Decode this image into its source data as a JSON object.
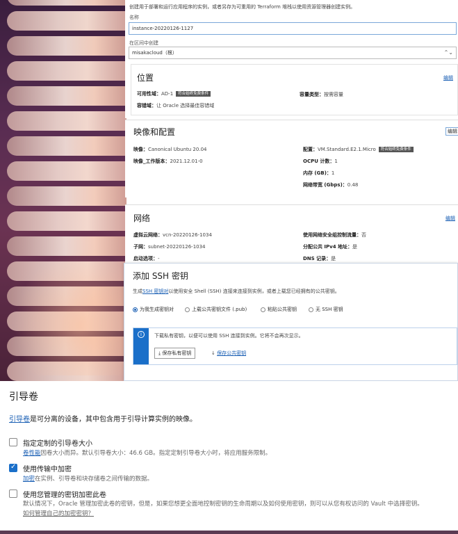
{
  "intro_text": "创建用于部署和运行应用程序的实例，或者另存为可重用的 Terraform 堆栈以使用资源管理器创建实例。",
  "name_label": "名称",
  "name_value": "instance-20220126-1127",
  "compartment_label": "在区间中创建",
  "compartment_value": "misakacloud（根）",
  "placement": {
    "title": "位置",
    "edit": "编辑",
    "ad_label": "可用性域：",
    "ad_value": "AD-1",
    "ad_badge": "符合始终免费条件",
    "capacity_label": "容量类型：",
    "capacity_value": "按需容量",
    "fault_label": "容错域：",
    "fault_value": "让 Oracle 选择最佳容错域"
  },
  "image_shape": {
    "title": "映像和配置",
    "edit": "编辑",
    "image_label": "映像：",
    "image_value": "Canonical Ubuntu 20.04",
    "build_label": "映像_工作版本：",
    "build_value": "2021.12.01-0",
    "shape_label": "配置：",
    "shape_value": "VM.Standard.E2.1.Micro",
    "shape_badge": "符合始终免费条件",
    "ocpu_label": "OCPU 计数：",
    "ocpu_value": "1",
    "mem_label": "内存 (GB)：",
    "mem_value": "1",
    "bw_label": "网络带宽 (Gbps)：",
    "bw_value": "0.48"
  },
  "network": {
    "title": "网络",
    "edit": "编辑",
    "vcn_label": "虚拟云网络：",
    "vcn_value": "vcn-20220126-1034",
    "nsg_label": "使用网络安全组控制流量：",
    "nsg_value": "否",
    "subnet_label": "子网：",
    "subnet_value": "subnet-20220126-1034",
    "ip_label": "分配公共 IPv4 地址：",
    "ip_value": "是",
    "launch_label": "启动选项：",
    "launch_value": "-",
    "dns_label": "DNS 记录：",
    "dns_value": "是"
  },
  "ssh": {
    "title": "添加 SSH 密钥",
    "desc_prefix": "生成",
    "desc_link": "SSH 密钥对",
    "desc_suffix": "以使用安全 Shell (SSH) 连接来连接到实例，或者上载您已经拥有的公共密钥。",
    "options": [
      "为我生成密钥对",
      "上载公共密钥文件 (.pub)",
      "粘贴公共密钥",
      "无 SSH 密钥"
    ],
    "info_text": "下载私有密钥，以便可以使用 SSH 连接到实例。它将不会再次显示。",
    "save_private": "保存私有密钥",
    "save_public": "保存公共密钥"
  },
  "boot": {
    "title": "引导卷",
    "desc_link": "引导卷",
    "desc_rest": "是可分离的设备，其中包含用于引导计算实例的映像。",
    "opt1_label": "指定定制的引导卷大小",
    "opt1_link": "卷性能",
    "opt1_help": "因卷大小而异。默认引导卷大小：46.6 GB。指定定制引导卷大小时，将应用服务限制。",
    "opt2_label": "使用传输中加密",
    "opt2_link": "加密",
    "opt2_help": "在实例、引导卷和块存储卷之间传输的数据。",
    "opt3_label": "使用您管理的密钥加密此卷",
    "opt3_help": "默认情况下，Oracle 管理加密此卷的密钥，但是，如果您想更全面地控制密钥的生命周期以及如何使用密钥，则可以从您有权访问的 Vault 中选择密钥。",
    "opt3_link": "如何管理自己的加密密钥？"
  }
}
